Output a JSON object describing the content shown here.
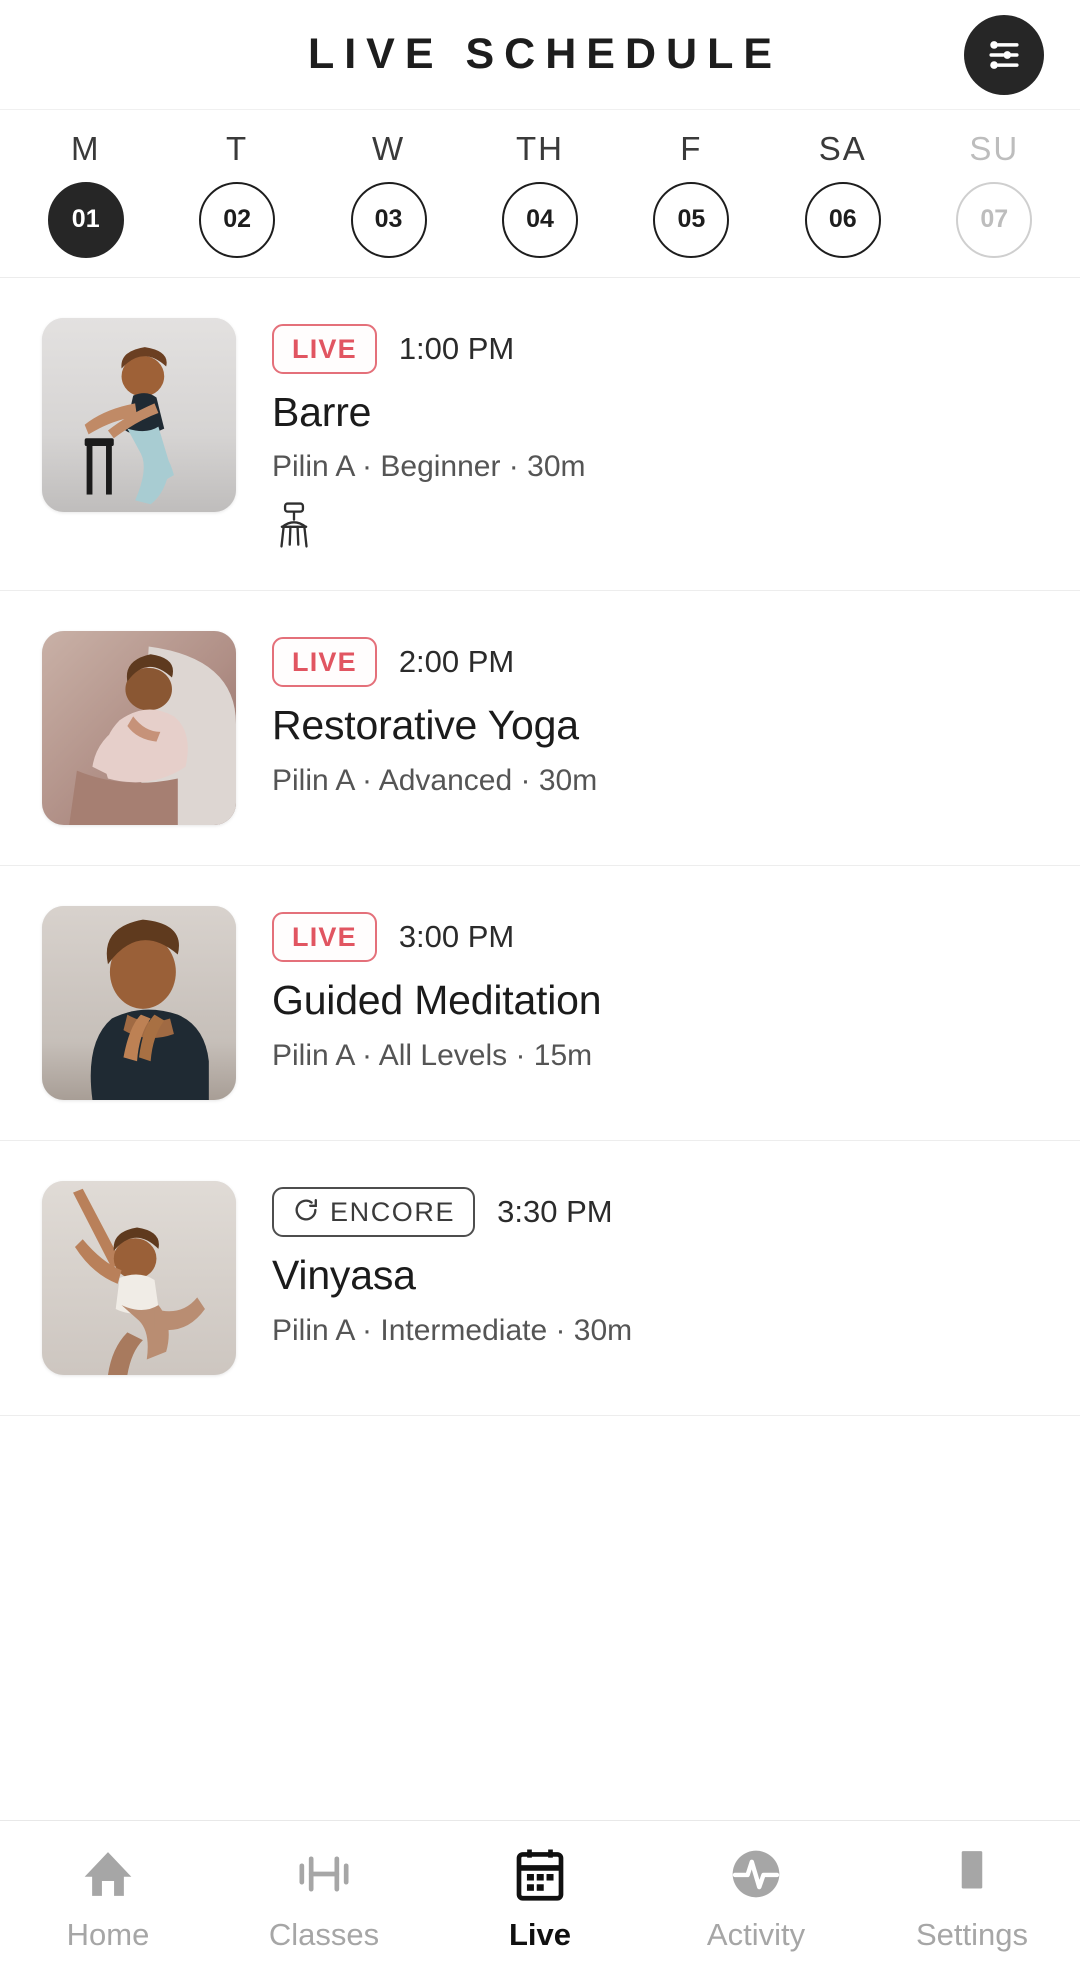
{
  "header": {
    "title": "LIVE SCHEDULE",
    "filter_icon": "sliders-filter-icon"
  },
  "day_strip": {
    "days": [
      {
        "letter": "M",
        "number": "01",
        "state": "selected"
      },
      {
        "letter": "T",
        "number": "02",
        "state": "default"
      },
      {
        "letter": "W",
        "number": "03",
        "state": "default"
      },
      {
        "letter": "TH",
        "number": "04",
        "state": "default"
      },
      {
        "letter": "F",
        "number": "05",
        "state": "default"
      },
      {
        "letter": "SA",
        "number": "06",
        "state": "default"
      },
      {
        "letter": "SU",
        "number": "07",
        "state": "disabled"
      }
    ]
  },
  "classes": [
    {
      "badge": "LIVE",
      "badge_type": "live",
      "time": "1:00 PM",
      "title": "Barre",
      "meta": "Pilin A · Beginner · 30m",
      "equipment_icon": "chair-icon",
      "thumbnail": "barre-stretch-photo"
    },
    {
      "badge": "LIVE",
      "badge_type": "live",
      "time": "2:00 PM",
      "title": "Restorative Yoga",
      "meta": "Pilin A · Advanced · 30m",
      "equipment_icon": "",
      "thumbnail": "restorative-reclining-photo"
    },
    {
      "badge": "LIVE",
      "badge_type": "live",
      "time": "3:00 PM",
      "title": "Guided Meditation",
      "meta": "Pilin A · All Levels · 15m",
      "equipment_icon": "",
      "thumbnail": "meditation-prayer-hands-photo"
    },
    {
      "badge": "ENCORE",
      "badge_type": "encore",
      "time": "3:30 PM",
      "title": "Vinyasa",
      "meta": "Pilin A · Intermediate · 30m",
      "equipment_icon": "",
      "thumbnail": "vinyasa-dancer-pose-photo"
    }
  ],
  "bottom_nav": {
    "items": [
      {
        "label": "Home",
        "icon": "home-icon",
        "active": false
      },
      {
        "label": "Classes",
        "icon": "dumbbell-icon",
        "active": false
      },
      {
        "label": "Live",
        "icon": "calendar-icon",
        "active": true
      },
      {
        "label": "Activity",
        "icon": "pulse-icon",
        "active": false
      },
      {
        "label": "Settings",
        "icon": "gear-icon",
        "active": false
      }
    ]
  },
  "colors": {
    "live_accent": "#e15561",
    "ink": "#1d1d1d",
    "muted": "#a6a6a6",
    "divider": "#ededed"
  }
}
